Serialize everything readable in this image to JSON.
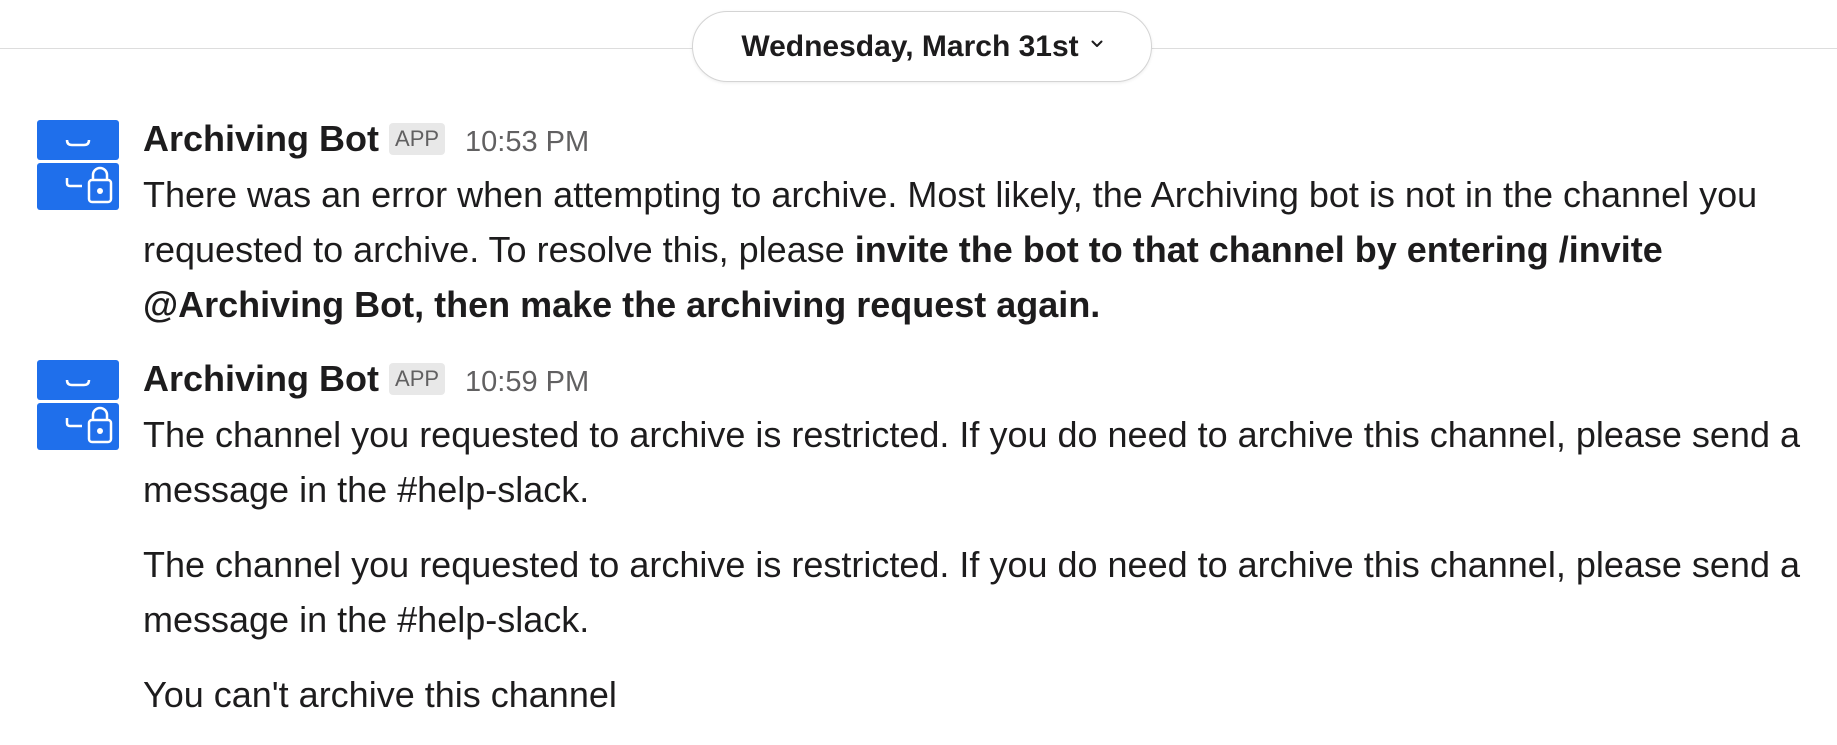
{
  "divider": {
    "date_label": "Wednesday, March 31st",
    "chevron_icon": "chevron-down-icon"
  },
  "colors": {
    "avatar_blue": "#1f6feb",
    "text": "#1d1c1d",
    "muted": "#616061",
    "badge_bg": "#e8e8e8"
  },
  "messages": [
    {
      "sender": "Archiving Bot",
      "badge": "APP",
      "time": "10:53 PM",
      "avatar_icon": "archive-lock-icon",
      "text_plain": "There was an error when attempting to archive. Most likely, the Archiving bot is not in the channel you requested to archive. To resolve this, please ",
      "text_bold": "invite the bot to that channel by entering /invite @Archiving Bot, then make the archiving request again."
    },
    {
      "sender": "Archiving Bot",
      "badge": "APP",
      "time": "10:59 PM",
      "avatar_icon": "archive-lock-icon",
      "paragraphs": [
        {
          "text_before": "The channel you requested to archive is restricted. If you do need to archive this channel, please send a message in the ",
          "channel_link": "#help-slack",
          "text_after": "."
        },
        {
          "text_before": "The channel you requested to archive is restricted. If you do need to archive this channel, please send a message in the ",
          "channel_link": "#help-slack",
          "text_after": "."
        },
        {
          "text": "You can't archive this channel"
        }
      ]
    }
  ]
}
